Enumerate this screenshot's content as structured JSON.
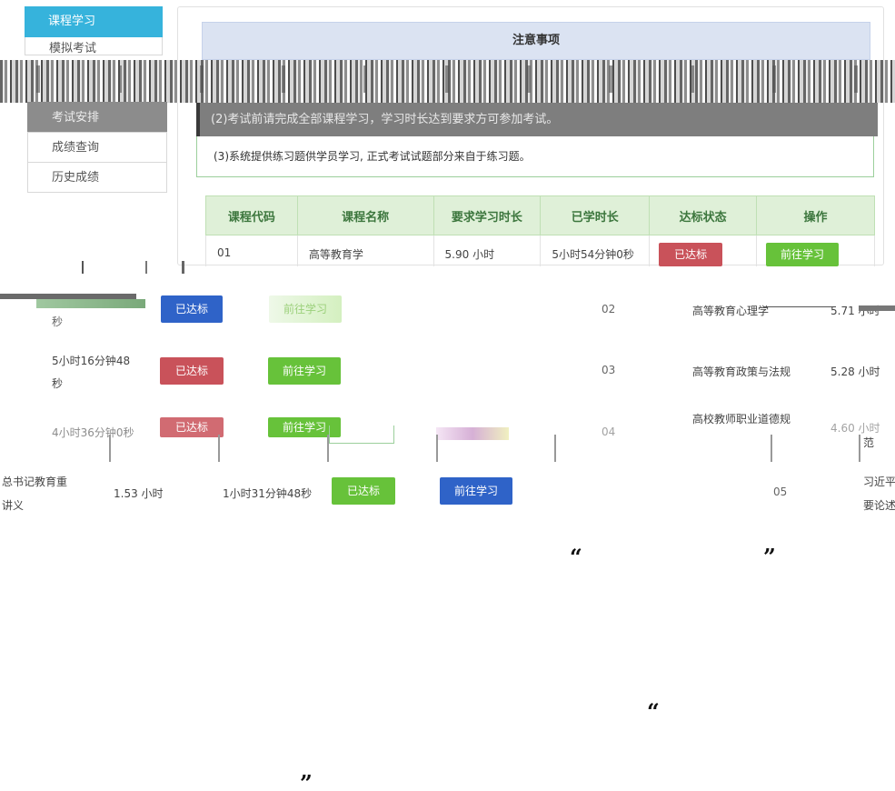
{
  "sidebar_top": {
    "active_item": "课程学习",
    "item_2": "模拟考试"
  },
  "sidebar_lower": {
    "items": [
      "考试安排",
      "成绩查询",
      "历史成绩"
    ]
  },
  "notice": {
    "title": "注意事项",
    "rule_2_garbled": "(2)考试前请完成全部课程学习，学习时长达到要求方可参加考试。",
    "rule_3": "(3)系统提供练习题供学员学习, 正式考试试题部分来自于练习题。"
  },
  "table": {
    "headers": [
      "课程代码",
      "课程名称",
      "要求学习时长",
      "已学时长",
      "达标状态",
      "操作"
    ],
    "row_01": {
      "code": "01",
      "name": "高等教育学",
      "required": "5.90 小时",
      "learned": "5小时54分钟0秒",
      "status": "已达标",
      "action": "前往学习"
    }
  },
  "lower_rows": {
    "row_a": {
      "learned_tail": "秒",
      "status": "已达标",
      "action": "前往学习",
      "code": "02",
      "name": "高等教育心理学",
      "required": "5.71 小时"
    },
    "row_b": {
      "learned_line1": "5小时16分钟48",
      "learned_line2": "秒",
      "status": "已达标",
      "action": "前往学习",
      "code": "03",
      "name": "高等教育政策与法规",
      "required": "5.28 小时"
    },
    "row_c": {
      "learned": "4小时36分钟0秒",
      "status": "已达标",
      "action": "前往学习",
      "code": "04",
      "name_line1": "高校教师职业道德规",
      "name_line2": "范",
      "required": "4.60 小时"
    },
    "row_d": {
      "name_left_line1": "总书记教育重",
      "name_left_line2": "讲义",
      "required": "1.53 小时",
      "learned": "1小时31分钟48秒",
      "status": "已达标",
      "action": "前往学习",
      "code": "05",
      "name_right_line1": "习近平",
      "name_right_line2": "要论述"
    }
  },
  "quotes": {
    "open": "“",
    "close": "”"
  },
  "colors": {
    "sidebar_active": "#36b3dc",
    "header_green_bg": "#dff0d8",
    "header_green_text": "#3c763d",
    "status_red": "#c9525a",
    "action_green": "#67c23a",
    "action_blue": "#2f63c8",
    "notice_bg": "#dbe3f2"
  }
}
